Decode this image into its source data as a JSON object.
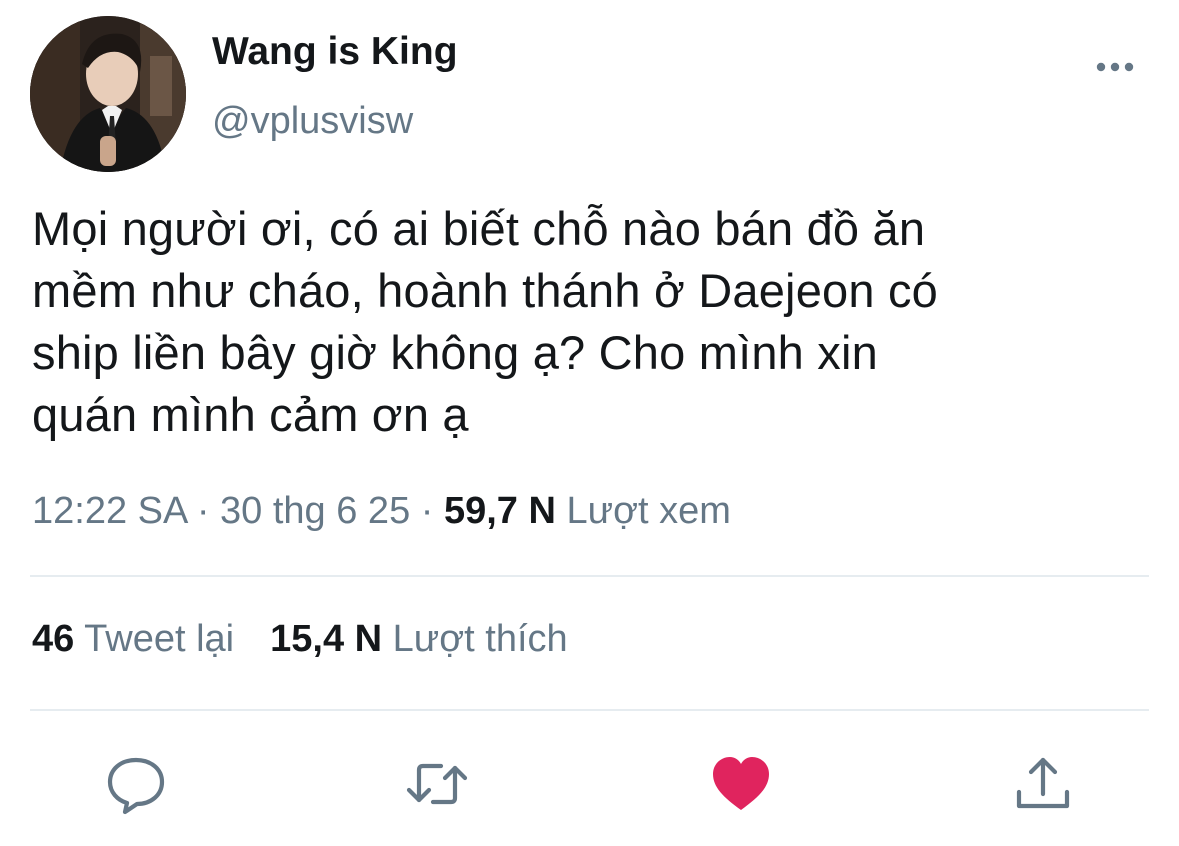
{
  "author": {
    "display_name": "Wang is King",
    "handle": "@vplusvisw",
    "avatar_icon": "profile-photo"
  },
  "header": {
    "more_icon": "more-horizontal-icon"
  },
  "tweet": {
    "text": "Mọi người ơi, có ai biết chỗ nào bán đồ ăn\nmềm như cháo, hoành thánh ở Daejeon có\nship liền bây giờ không ạ? Cho mình xin\nquán mình cảm ơn ạ"
  },
  "meta": {
    "time": "12:22 SA",
    "separator": "·",
    "date": "30 thg 6 25",
    "views_count": "59,7 N",
    "views_label": "Lượt xem"
  },
  "stats": {
    "retweets_count": "46",
    "retweets_label": "Tweet lại",
    "likes_count": "15,4 N",
    "likes_label": "Lượt thích"
  },
  "actions": {
    "reply_icon": "reply-icon",
    "retweet_icon": "retweet-icon",
    "like_icon": "heart-icon",
    "share_icon": "share-icon",
    "like_color": "#e0245e",
    "icon_color": "#657786"
  }
}
